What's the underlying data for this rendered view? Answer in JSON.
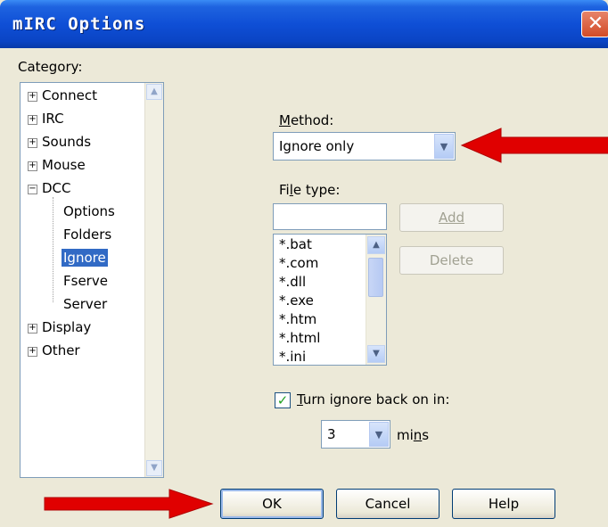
{
  "window": {
    "title": "mIRC Options",
    "close_glyph": "✕"
  },
  "category": {
    "label": "Category:",
    "items": [
      {
        "label": "Connect",
        "expander": "+"
      },
      {
        "label": "IRC",
        "expander": "+"
      },
      {
        "label": "Sounds",
        "expander": "+"
      },
      {
        "label": "Mouse",
        "expander": "+"
      },
      {
        "label": "DCC",
        "expander": "−",
        "children": [
          "Options",
          "Folders",
          "Ignore",
          "Fserve",
          "Server"
        ],
        "selected_child": "Ignore"
      },
      {
        "label": "Display",
        "expander": "+"
      },
      {
        "label": "Other",
        "expander": "+"
      }
    ]
  },
  "method": {
    "label_accel": "M",
    "label_rest": "ethod:",
    "value": "Ignore only"
  },
  "filetype": {
    "label_pre": "Fi",
    "label_accel": "l",
    "label_post": "e type:",
    "input_value": "",
    "add_label": "Add",
    "delete_label": "Delete",
    "list": [
      "*.bat",
      "*.com",
      "*.dll",
      "*.exe",
      "*.htm",
      "*.html",
      "*.ini"
    ]
  },
  "ignore": {
    "checked": true,
    "check_glyph": "✓",
    "label_accel": "T",
    "label_rest": "urn ignore back on in:",
    "value": "3",
    "unit_pre": "mi",
    "unit_accel": "n",
    "unit_post": "s"
  },
  "footer": {
    "ok": "OK",
    "cancel": "Cancel",
    "help": "Help"
  },
  "colors": {
    "title_bar": "#0a44c4",
    "dialog_bg": "#ece9d8",
    "arrow": "#e00000",
    "selection": "#316ac5"
  },
  "icons": {
    "dropdown": "chevron-down-icon",
    "scroll_up": "chevron-up-icon",
    "close": "close-icon",
    "annotation": "red-arrow-icon"
  }
}
